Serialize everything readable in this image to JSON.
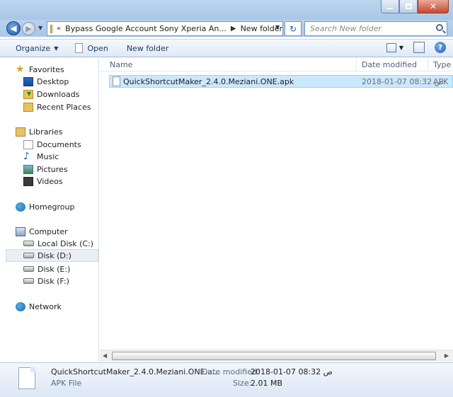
{
  "window": {
    "minimize_icon": "minimize-icon",
    "maximize_icon": "maximize-icon",
    "close_icon": "close-icon"
  },
  "address": {
    "overflow": "«",
    "crumbs": [
      "Bypass Google Account Sony Xperia An...",
      "New folder"
    ],
    "search_placeholder": "Search New folder"
  },
  "toolbar": {
    "organize": "Organize",
    "open": "Open",
    "new_folder": "New folder"
  },
  "nav": {
    "favorites": "Favorites",
    "desktop": "Desktop",
    "downloads": "Downloads",
    "recent": "Recent Places",
    "libraries": "Libraries",
    "documents": "Documents",
    "music": "Music",
    "pictures": "Pictures",
    "videos": "Videos",
    "homegroup": "Homegroup",
    "computer": "Computer",
    "disk_c": "Local Disk (C:)",
    "disk_d": "Disk (D:)",
    "disk_e": "Disk (E:)",
    "disk_f": "Disk (F:)",
    "network": "Network"
  },
  "columns": {
    "name": "Name",
    "date": "Date modified",
    "type": "Type"
  },
  "file": {
    "name": "QuickShortcutMaker_2.4.0.Meziani.ONE.apk",
    "date": "2018-01-07 ص 08:32",
    "type": "APK"
  },
  "details": {
    "name": "QuickShortcutMaker_2.4.0.Meziani.ONE.a...",
    "type": "APK File",
    "date_label": "Date modified:",
    "date_value": "2018-01-07 ص 08:32",
    "size_label": "Size:",
    "size_value": "2.01 MB"
  },
  "colors": {
    "selection": "#cce8ff",
    "selection_border": "#99d1ff",
    "chrome": "#b9d1ec",
    "link": "#1e3b63"
  }
}
